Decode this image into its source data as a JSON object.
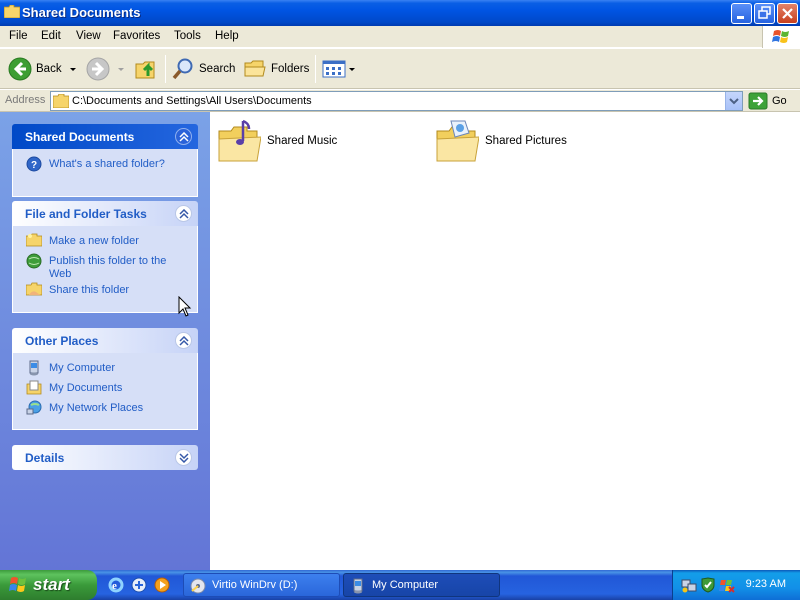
{
  "window": {
    "title": "Shared Documents",
    "title_icon": "folder-icon"
  },
  "menubar": {
    "items": [
      "File",
      "Edit",
      "View",
      "Favorites",
      "Tools",
      "Help"
    ]
  },
  "toolbar": {
    "back_label": "Back",
    "search_label": "Search",
    "folders_label": "Folders"
  },
  "address": {
    "label": "Address",
    "path": "C:\\Documents and Settings\\All Users\\Documents",
    "go_label": "Go"
  },
  "taskpane": {
    "shared_panel": {
      "title": "Shared Documents",
      "tasks": [
        {
          "label": "What's a shared folder?",
          "icon": "help-icon"
        }
      ]
    },
    "file_tasks_panel": {
      "title": "File and Folder Tasks",
      "tasks": [
        {
          "label": "Make a new folder",
          "icon": "new-folder-icon"
        },
        {
          "label": "Publish this folder to the Web",
          "icon": "globe-icon"
        },
        {
          "label": "Share this folder",
          "icon": "share-folder-icon"
        }
      ]
    },
    "other_places_panel": {
      "title": "Other Places",
      "tasks": [
        {
          "label": "My Computer",
          "icon": "computer-icon"
        },
        {
          "label": "My Documents",
          "icon": "documents-icon"
        },
        {
          "label": "My Network Places",
          "icon": "network-icon"
        }
      ]
    },
    "details_panel": {
      "title": "Details"
    }
  },
  "content": {
    "items": [
      {
        "name": "Shared Music",
        "icon": "music-folder-icon"
      },
      {
        "name": "Shared Pictures",
        "icon": "pictures-folder-icon"
      }
    ]
  },
  "taskbar": {
    "start_label": "start",
    "buttons": [
      {
        "label": "Virtio WinDrv (D:)",
        "icon": "cd-drive-icon"
      },
      {
        "label": "My Computer",
        "icon": "computer-icon"
      }
    ],
    "clock": "9:23 AM"
  },
  "colors": {
    "titlebar_blue": "#0054e3",
    "taskpane_link": "#215dc6",
    "start_green": "#3a9a3a"
  }
}
